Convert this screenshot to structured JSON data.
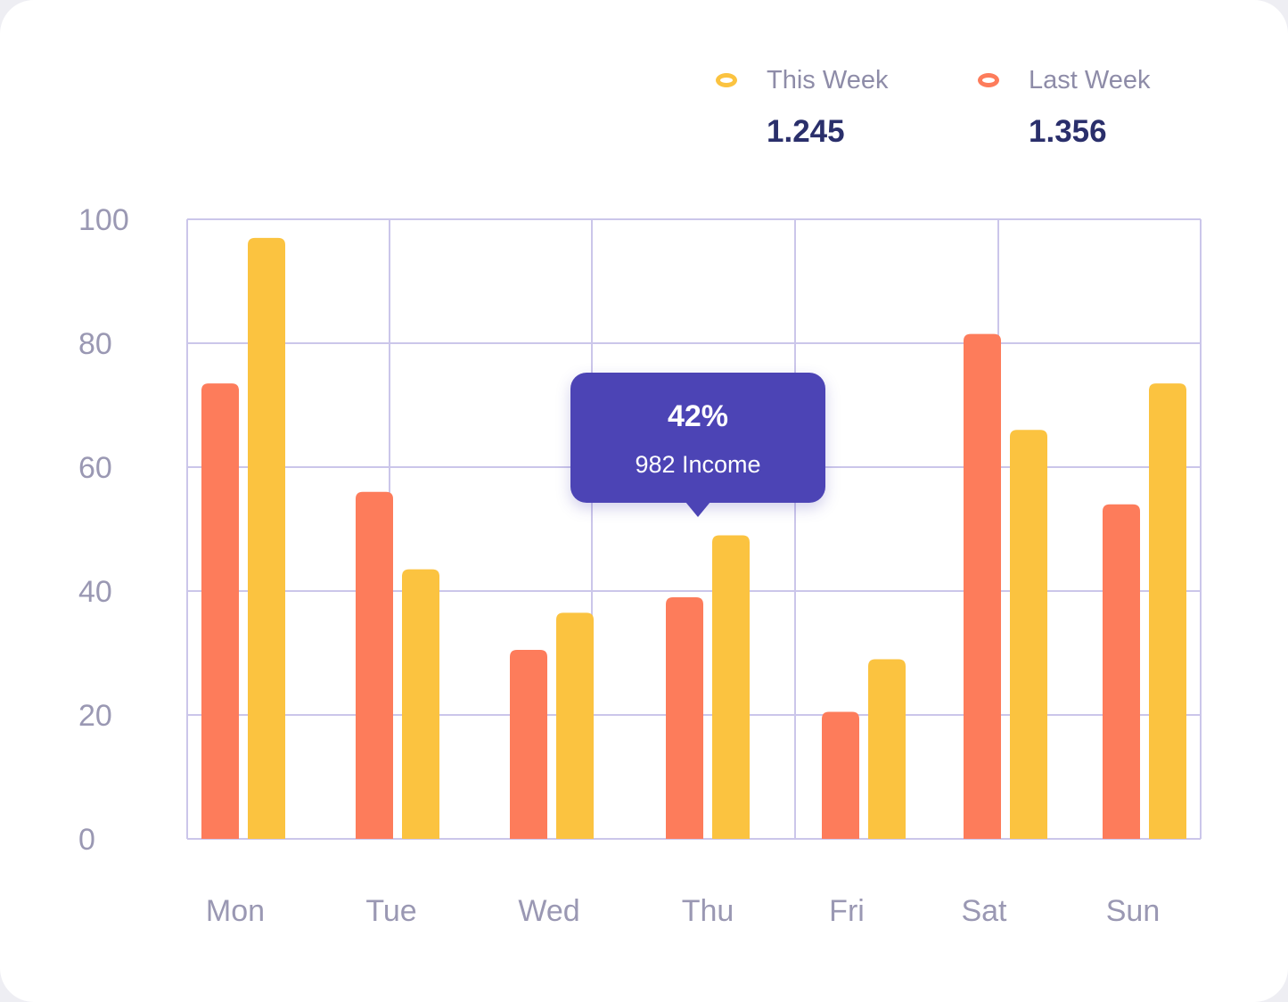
{
  "legend": [
    {
      "label": "This Week",
      "value": "1.245",
      "color": "#fbc340"
    },
    {
      "label": "Last Week",
      "value": "1.356",
      "color": "#fd7c5b"
    }
  ],
  "tooltip": {
    "percent": "42%",
    "text": "982 Income"
  },
  "chart_data": {
    "type": "bar",
    "categories": [
      "Mon",
      "Tue",
      "Wed",
      "Thu",
      "Fri",
      "Sat",
      "Sun"
    ],
    "highlighted_category": "Wed",
    "series": [
      {
        "name": "Last Week",
        "color": "#fd7c5b",
        "values": [
          73.5,
          56,
          30.5,
          39,
          20.5,
          81.5,
          54
        ]
      },
      {
        "name": "This Week",
        "color": "#fbc340",
        "values": [
          97,
          43.5,
          36.5,
          49,
          29,
          66,
          73.5
        ]
      }
    ],
    "ylim": [
      0,
      100
    ],
    "yticks": [
      0,
      20,
      40,
      60,
      80,
      100
    ],
    "grid": true,
    "legend_position": "top-right",
    "colors": {
      "grid": "#cbc6ea",
      "tick_label": "#9a98b3",
      "highlight_label": "#2a2f6b"
    }
  }
}
